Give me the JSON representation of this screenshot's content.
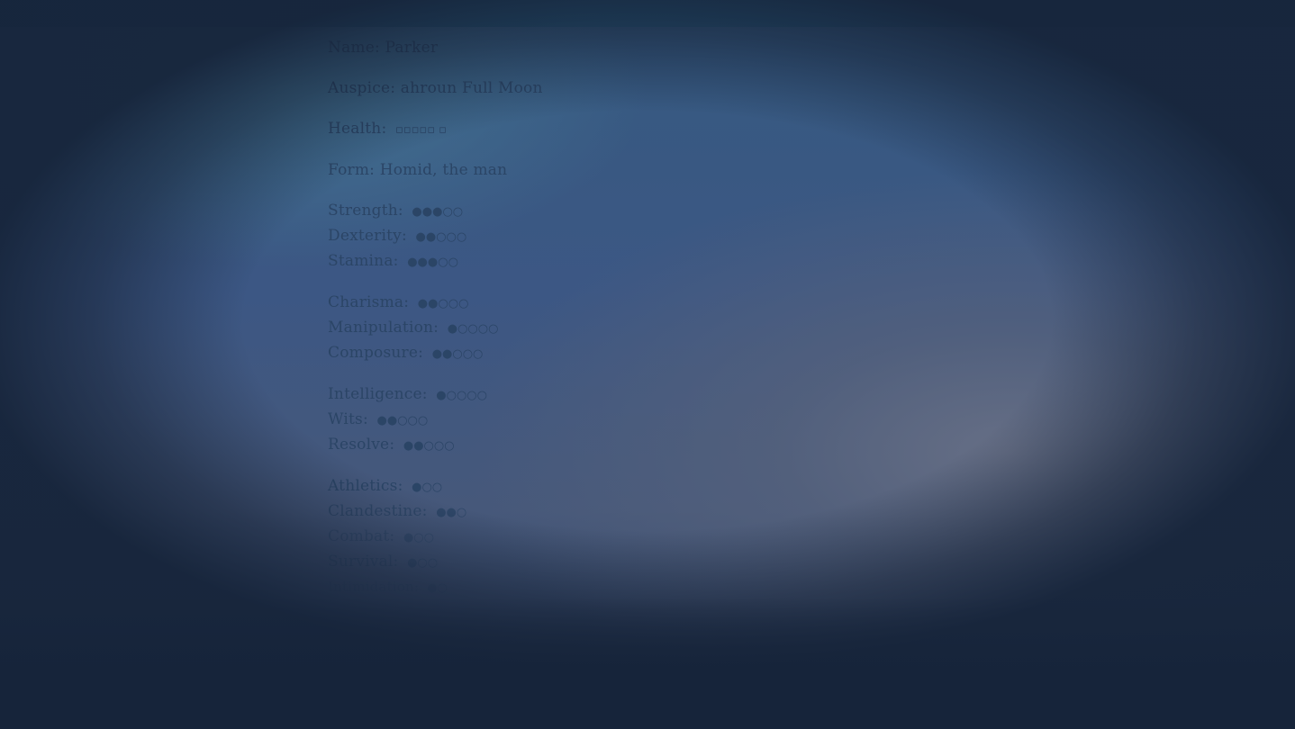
{
  "sheet": {
    "name_label": "Name:",
    "name_value": "Parker",
    "auspice_label": "Auspice:",
    "auspice_value": "ahroun Full Moon",
    "health_label": "Health:",
    "health_value": "▫▫▫▫▫ ▫",
    "form_label": "Form:",
    "form_value": "Homid, the man",
    "physical": [
      {
        "label": "Strength:",
        "dots": "●●●○○"
      },
      {
        "label": "Dexterity:",
        "dots": "●●○○○"
      },
      {
        "label": "Stamina:",
        "dots": "●●●○○"
      }
    ],
    "social": [
      {
        "label": "Charisma:",
        "dots": "●●○○○"
      },
      {
        "label": "Manipulation:",
        "dots": "●○○○○"
      },
      {
        "label": "Composure:",
        "dots": "●●○○○"
      }
    ],
    "mental": [
      {
        "label": "Intelligence:",
        "dots": "●○○○○"
      },
      {
        "label": "Wits:",
        "dots": "●●○○○"
      },
      {
        "label": "Resolve:",
        "dots": "●●○○○"
      }
    ],
    "skills": [
      {
        "label": "Athletics:",
        "dots": "●○○"
      },
      {
        "label": "Clandestine:",
        "dots": "●●○"
      },
      {
        "label": "Combat:",
        "dots": "●○○"
      },
      {
        "label": "Survival:",
        "dots": "●○○"
      },
      {
        "label": "Intimidation:",
        "dots": "●○"
      }
    ]
  }
}
